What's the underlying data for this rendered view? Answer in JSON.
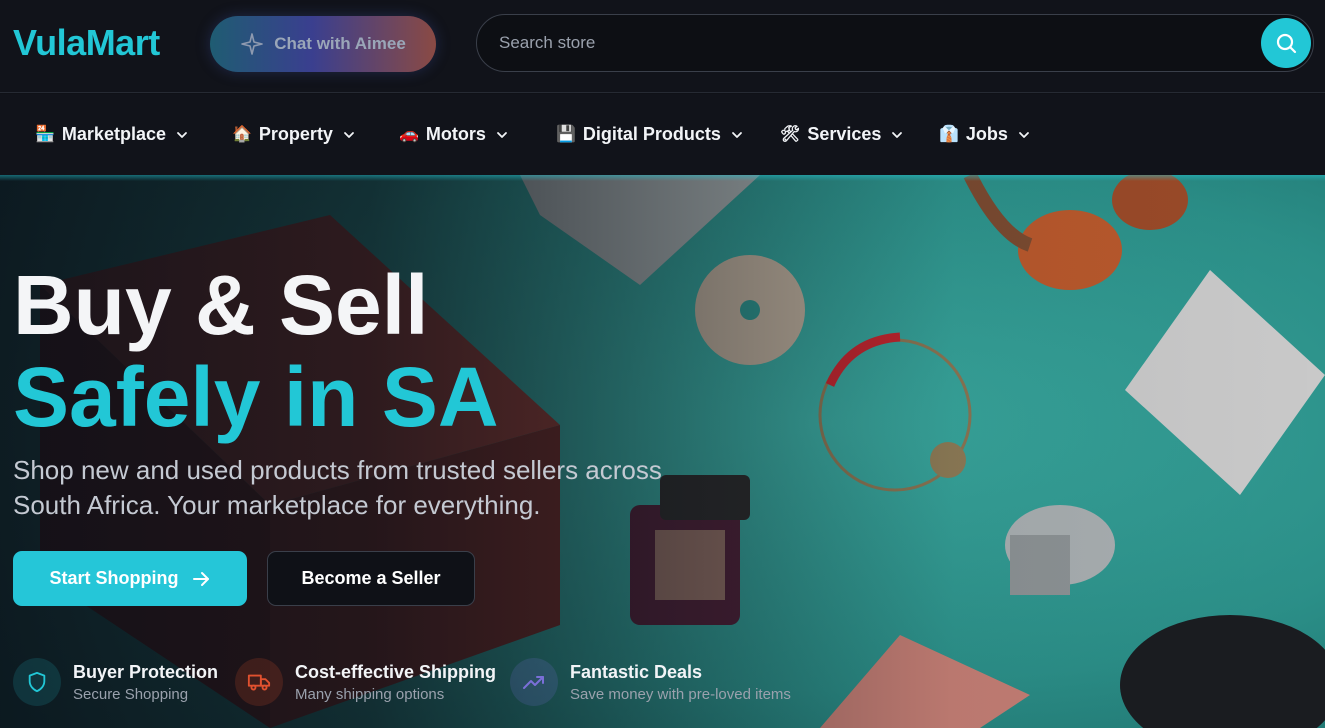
{
  "header": {
    "logo": "VulaMart",
    "chat_label": "Chat with Aimee",
    "search_placeholder": "Search store"
  },
  "nav": {
    "items": [
      {
        "icon": "🏪",
        "label": "Marketplace"
      },
      {
        "icon": "🏠",
        "label": "Property"
      },
      {
        "icon": "🚗",
        "label": "Motors"
      },
      {
        "icon": "💾",
        "label": "Digital Products"
      },
      {
        "icon": "🛠",
        "label": "Services"
      },
      {
        "icon": "👔",
        "label": "Jobs"
      }
    ]
  },
  "hero": {
    "headline_line1": "Buy & Sell",
    "headline_line2": "Safely in SA",
    "subtitle": "Shop new and used products from trusted sellers across South Africa. Your marketplace for everything.",
    "primary_button": "Start Shopping",
    "secondary_button": "Become a Seller"
  },
  "features": [
    {
      "title": "Buyer Protection",
      "subtitle": "Secure Shopping",
      "icon": "shield-icon",
      "color": "#22c7d6"
    },
    {
      "title": "Cost-effective Shipping",
      "subtitle": "Many shipping options",
      "icon": "truck-icon",
      "color": "#e0512f"
    },
    {
      "title": "Fantastic Deals",
      "subtitle": "Save money with pre-loved items",
      "icon": "trending-up-icon",
      "color": "#7a6fd8"
    }
  ],
  "colors": {
    "accent": "#22c7d6",
    "background": "#11131a"
  }
}
